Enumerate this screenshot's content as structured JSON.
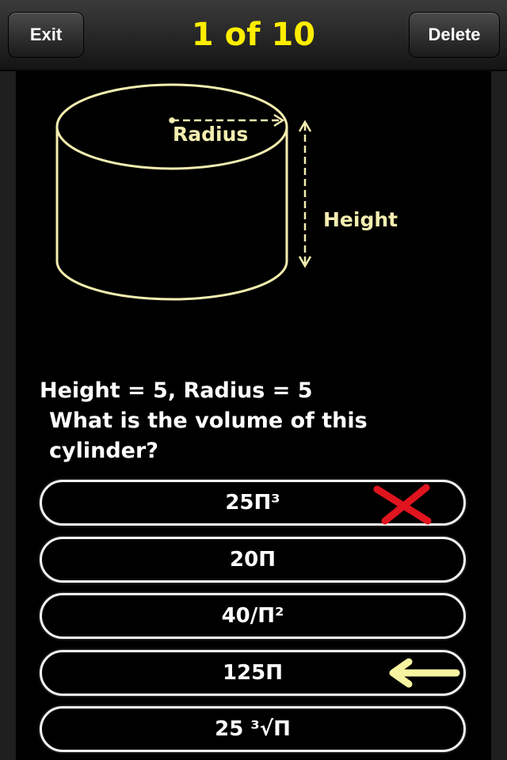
{
  "nav": {
    "exit_label": "Exit",
    "counter": "1 of 10",
    "delete_label": "Delete"
  },
  "diagram": {
    "radius_label": "Radius",
    "height_label": "Height"
  },
  "question": {
    "line1": "Height = 5, Radius = 5",
    "line2": "What is the volume of this cylinder?"
  },
  "answers": [
    {
      "label": "25Π³",
      "mark": "wrong-x-icon"
    },
    {
      "label": "20Π",
      "mark": ""
    },
    {
      "label": "40/Π²",
      "mark": ""
    },
    {
      "label": "125Π",
      "mark": "correct-arrow-icon"
    },
    {
      "label": "25 ³√Π",
      "mark": ""
    }
  ],
  "colors": {
    "counter": "#ffee00",
    "chalk_outline": "#f3eeb0",
    "wrong_mark": "#e0141e",
    "correct_mark": "#f6f4a0"
  }
}
